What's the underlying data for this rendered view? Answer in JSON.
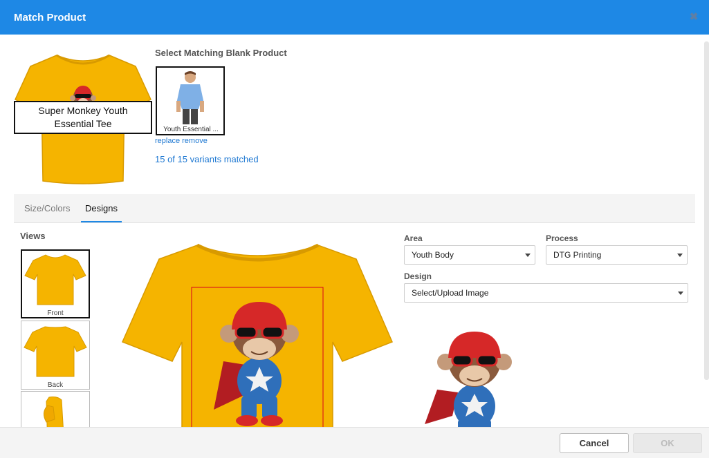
{
  "dialog": {
    "title": "Match Product",
    "close_icon": "close-icon"
  },
  "product": {
    "name": "Super Monkey Youth Essential Tee",
    "shirt_color": "#f5b400",
    "section_title": "Select Matching Blank Product",
    "blank_caption": "Youth Essential ...",
    "replace_label": "replace",
    "remove_label": "remove",
    "matched_text": "15 of 15 variants matched"
  },
  "tabs": [
    {
      "label": "Size/Colors",
      "active": false
    },
    {
      "label": "Designs",
      "active": true
    }
  ],
  "views": {
    "title": "Views",
    "items": [
      {
        "label": "Front",
        "selected": true
      },
      {
        "label": "Back",
        "selected": false
      },
      {
        "label": "",
        "selected": false
      }
    ]
  },
  "form": {
    "area_label": "Area",
    "area_value": "Youth Body",
    "process_label": "Process",
    "process_value": "DTG Printing",
    "design_label": "Design",
    "design_value": "Select/Upload Image"
  },
  "footer": {
    "cancel_label": "Cancel",
    "ok_label": "OK"
  },
  "colors": {
    "header_blue": "#1e88e5",
    "link_blue": "#1e78d2",
    "shirt_gold": "#f5b400",
    "print_area_red": "#d9001b"
  }
}
